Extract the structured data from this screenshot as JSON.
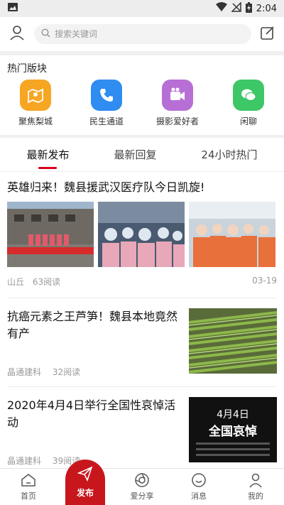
{
  "status": {
    "time": "2:04"
  },
  "search": {
    "placeholder": "搜索关键词"
  },
  "hot": {
    "title": "热门版块",
    "items": [
      {
        "label": "聚焦梨城",
        "icon": "map-icon",
        "color": "#f6a623"
      },
      {
        "label": "民生通道",
        "icon": "phone-icon",
        "color": "#2f8cf0"
      },
      {
        "label": "摄影爱好者",
        "icon": "camera-icon",
        "color": "#b76fd6"
      },
      {
        "label": "闲聊",
        "icon": "chat-icon",
        "color": "#3ec766"
      }
    ]
  },
  "tabs": [
    {
      "label": "最新发布",
      "active": true
    },
    {
      "label": "最新回复",
      "active": false
    },
    {
      "label": "24小时热门",
      "active": false
    }
  ],
  "articles": [
    {
      "title": "英雄归来！魏县援武汉医疗队今日凯旋!",
      "author": "山丘",
      "reads": "63阅读",
      "date": "03-19"
    },
    {
      "title": "抗癌元素之王芦笋！魏县本地竟然有产",
      "author": "晶通建科",
      "reads": "32阅读"
    },
    {
      "title": "2020年4月4日举行全国性哀悼活动",
      "author": "晶通建科",
      "reads": "39阅读",
      "thumb_text": {
        "line1": "4月4日",
        "line2": "全国哀悼"
      }
    }
  ],
  "nav": {
    "home": "首页",
    "publish": "发布",
    "share": "爱分享",
    "messages": "消息",
    "mine": "我的"
  },
  "colors": {
    "accent": "#c8161d",
    "tab_underline": "#d9001b"
  }
}
